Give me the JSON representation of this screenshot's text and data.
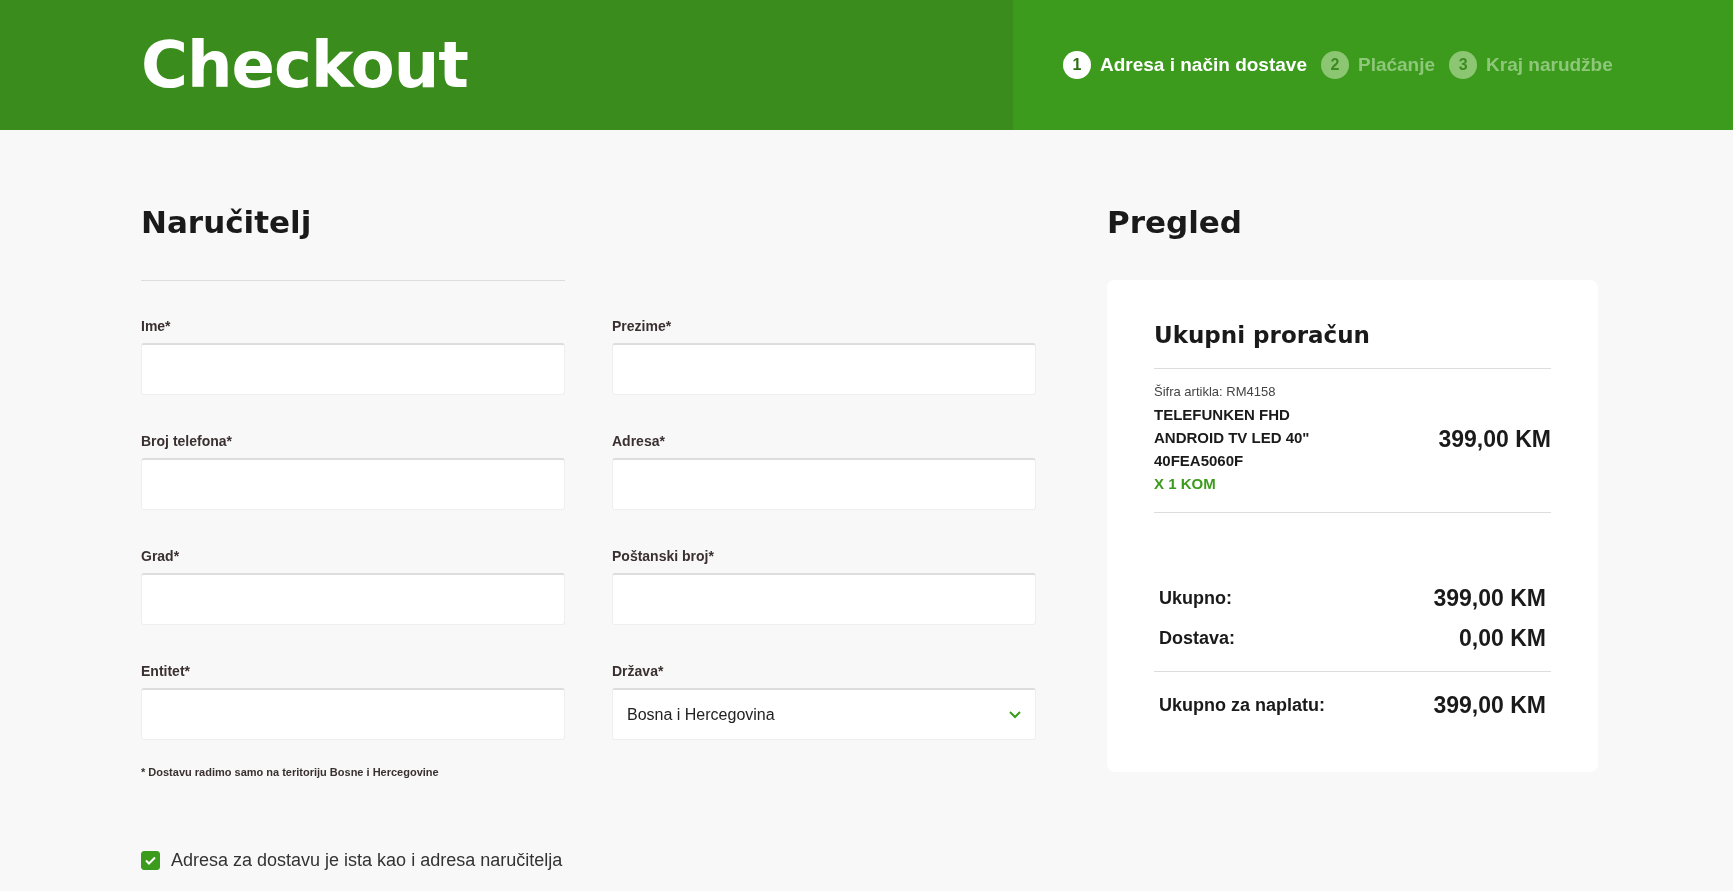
{
  "header": {
    "title": "Checkout",
    "steps": [
      {
        "number": "1",
        "label": "Adresa i način dostave",
        "selected": true
      },
      {
        "number": "2",
        "label": "Plaćanje",
        "selected": false
      },
      {
        "number": "3",
        "label": "Kraj narudžbe",
        "selected": false
      }
    ]
  },
  "form": {
    "heading": "Naručitelj",
    "fields": [
      {
        "label": "Ime*",
        "kind": "text"
      },
      {
        "label": "Prezime*",
        "kind": "text"
      },
      {
        "label": "Broj telefona*",
        "kind": "text"
      },
      {
        "label": "Adresa*",
        "kind": "text"
      },
      {
        "label": "Grad*",
        "kind": "text"
      },
      {
        "label": "Poštanski broj*",
        "kind": "text"
      },
      {
        "label": "Entitet*",
        "kind": "text"
      },
      {
        "label": "Država*",
        "kind": "select",
        "value": "Bosna i Hercegovina"
      }
    ],
    "note": "* Dostavu radimo samo na teritoriju Bosne i Hercegovine",
    "same_address": {
      "label": "Adresa za dostavu je ista kao i adresa naručitelja",
      "checked": true
    }
  },
  "summary": {
    "heading": "Pregled",
    "card_title": "Ukupni proračun",
    "items": [
      {
        "code": "Šifra artikla: RM4158",
        "name": "TELEFUNKEN FHD ANDROID TV LED 40\" 40FEA5060F",
        "quantity": "X 1 KOM",
        "price": "399,00 KM"
      }
    ],
    "totals": [
      {
        "label": "Ukupno:",
        "amount": "399,00 KM"
      },
      {
        "label": "Dostava:",
        "amount": "0,00 KM"
      }
    ],
    "grand_total": {
      "label": "Ukupno za naplatu:",
      "amount": "399,00 KM"
    }
  }
}
